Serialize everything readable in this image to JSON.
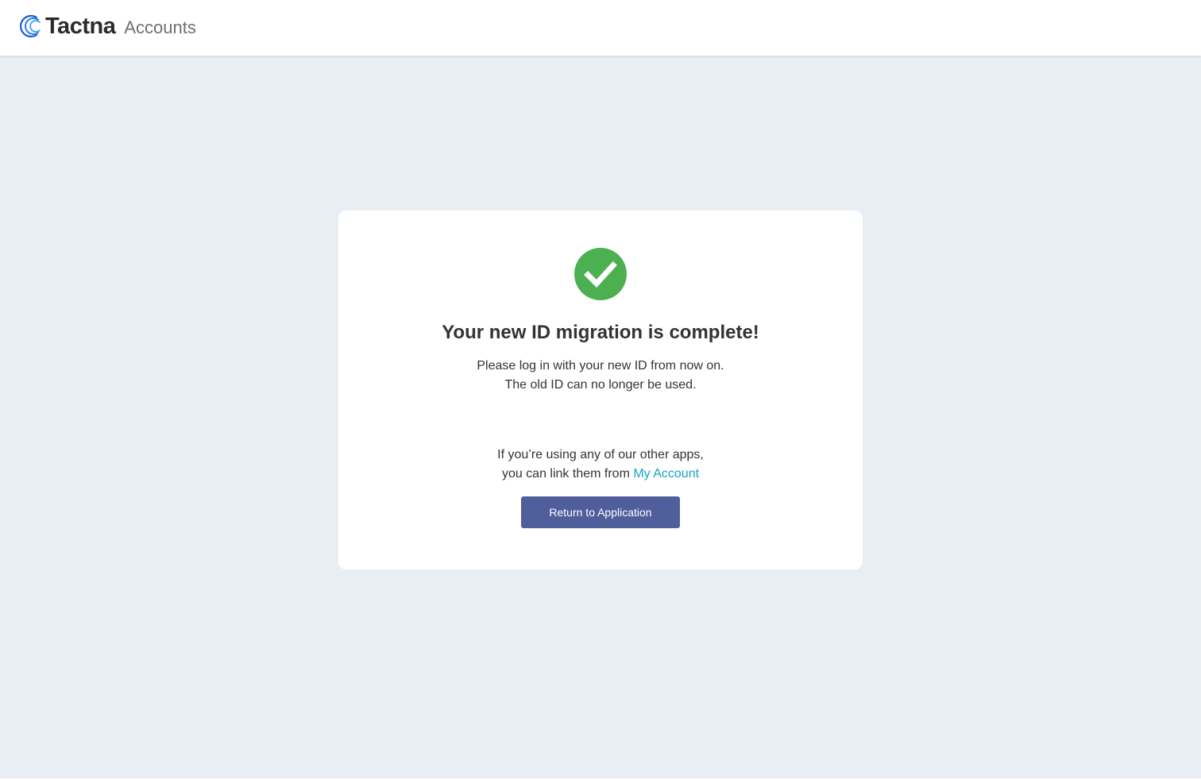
{
  "header": {
    "brand_name": "Tactna",
    "section_name": "Accounts",
    "logo_icon": "tactna-swirl-logo",
    "brand_color": "#1a5fd6"
  },
  "card": {
    "status_icon": "check-circle-icon",
    "status_color": "#4caf50",
    "title": "Your new ID migration is complete!",
    "message_lines": [
      "Please log in with your new ID from now on.",
      "The old ID can no longer be used."
    ],
    "apps_line_1": "If you’re using any of our other apps,",
    "apps_line_2_prefix": "you can link them from ",
    "my_account_link": "My Account",
    "link_color": "#1aa0c8",
    "return_button_label": "Return to Application",
    "button_color": "#4f5f9c"
  },
  "colors": {
    "page_background": "#e9eef5",
    "header_background": "#ffffff",
    "card_background": "#ffffff"
  }
}
